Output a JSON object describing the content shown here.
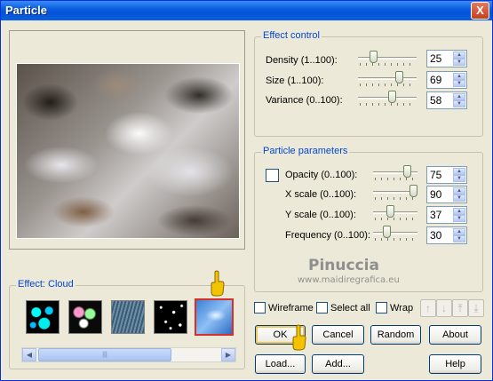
{
  "window": {
    "title": "Particle",
    "close_glyph": "X"
  },
  "effect_control": {
    "label": "Effect control",
    "rows": [
      {
        "label": "Density (1..100):",
        "value": "25",
        "level": 0.25
      },
      {
        "label": "Size (1..100):",
        "value": "69",
        "level": 0.69
      },
      {
        "label": "Variance (0..100):",
        "value": "58",
        "level": 0.58
      }
    ]
  },
  "particle_parameters": {
    "label": "Particle parameters",
    "rows": [
      {
        "label": "Opacity (0..100):",
        "value": "75",
        "level": 0.75
      },
      {
        "label": "X scale (0..100):",
        "value": "90",
        "level": 0.9
      },
      {
        "label": "Y scale (0..100):",
        "value": "37",
        "level": 0.37
      },
      {
        "label": "Frequency (0..100):",
        "value": "30",
        "level": 0.3
      }
    ]
  },
  "effect_gallery": {
    "label": "Effect: Cloud",
    "thumbnails": [
      "bubbles-thumbnail",
      "bokeh-thumbnail",
      "rain-thumbnail",
      "stars-thumbnail",
      "cloud-thumbnail"
    ],
    "selected": "cloud-thumbnail"
  },
  "options": {
    "wireframe": "Wireframe",
    "select_all": "Select all",
    "wrap": "Wrap"
  },
  "buttons": {
    "ok": "OK",
    "cancel": "Cancel",
    "random": "Random",
    "about": "About",
    "load": "Load...",
    "add": "Add...",
    "help": "Help"
  },
  "watermark": {
    "name": "Pinuccia",
    "url": "www.maidiregrafica.eu"
  },
  "colors": {
    "accent": "#0046d5",
    "titlebar": "#0a5fe0",
    "selected_border": "#d93025"
  }
}
